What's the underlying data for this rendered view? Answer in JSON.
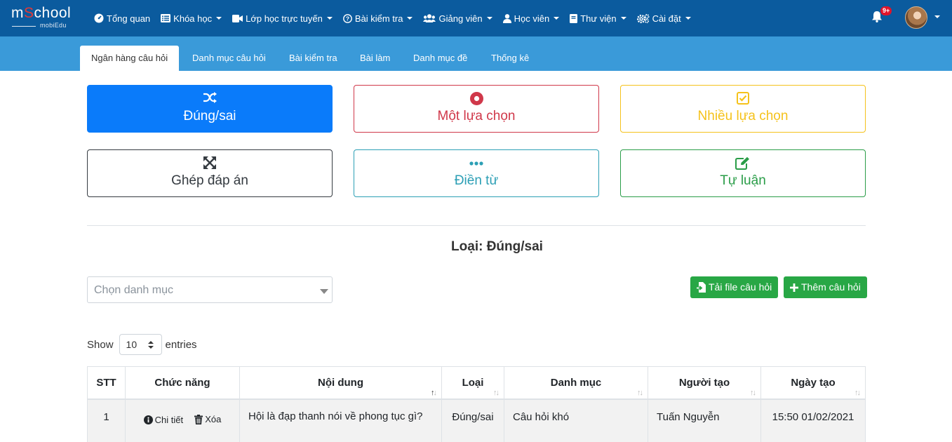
{
  "brand": {
    "logo_main_prefix": "m",
    "logo_main_o": "S",
    "logo_main_suffix": "chool",
    "logo_sub": "mobiEdu"
  },
  "nav": {
    "items": [
      {
        "label": "Tổng quan",
        "icon": "dashboard-icon",
        "dropdown": false
      },
      {
        "label": "Khóa học",
        "icon": "list-icon",
        "dropdown": true
      },
      {
        "label": "Lớp học trực tuyến",
        "icon": "video-icon",
        "dropdown": true
      },
      {
        "label": "Bài kiểm tra",
        "icon": "question-circle-icon",
        "dropdown": true
      },
      {
        "label": "Giảng viên",
        "icon": "users-icon",
        "dropdown": true
      },
      {
        "label": "Học viên",
        "icon": "user-icon",
        "dropdown": true
      },
      {
        "label": "Thư viện",
        "icon": "book-icon",
        "dropdown": true
      },
      {
        "label": "Cài đặt",
        "icon": "cogs-icon",
        "dropdown": true
      }
    ],
    "notification_badge": "9+"
  },
  "subnav": {
    "tabs": [
      {
        "label": "Ngân hàng câu hỏi",
        "active": true
      },
      {
        "label": "Danh mục câu hỏi",
        "active": false
      },
      {
        "label": "Bài kiểm tra",
        "active": false
      },
      {
        "label": "Bài làm",
        "active": false
      },
      {
        "label": "Danh mục đề",
        "active": false
      },
      {
        "label": "Thống kê",
        "active": false
      }
    ]
  },
  "question_types": [
    {
      "label": "Đúng/sai",
      "icon": "shuffle-icon",
      "color": "#0a7bfa"
    },
    {
      "label": "Một lựa chọn",
      "icon": "dot-circle-icon",
      "color": "#d0384a"
    },
    {
      "label": "Nhiều lựa chọn",
      "icon": "check-square-icon",
      "color": "#f5c21b"
    },
    {
      "label": "Ghép đáp án",
      "icon": "expand-arrows-icon",
      "color": "#343a40"
    },
    {
      "label": "Điền từ",
      "icon": "ellipsis-icon",
      "color": "#2c9fb5"
    },
    {
      "label": "Tự luận",
      "icon": "edit-icon",
      "color": "#2a9d48"
    }
  ],
  "section": {
    "title": "Loại: Đúng/sai"
  },
  "filter": {
    "category_placeholder": "Chọn danh mục"
  },
  "actions": {
    "upload_label": "Tải file câu hỏi",
    "add_label": "Thêm câu hỏi"
  },
  "length": {
    "show_label": "Show",
    "value": "10",
    "entries_label": "entries"
  },
  "table": {
    "headers": [
      "STT",
      "Chức năng",
      "Nội dung",
      "Loại",
      "Danh mục",
      "Người tạo",
      "Ngày tạo"
    ],
    "rows": [
      {
        "stt": "1",
        "detail_label": "Chi tiết",
        "delete_label": "Xóa",
        "content": "Hội là đạp thanh nói về phong tục gì?",
        "type": "Đúng/sai",
        "category": "Câu hỏi khó",
        "creator": "Tuấn Nguyễn",
        "created": "15:50 01/02/2021"
      }
    ]
  }
}
